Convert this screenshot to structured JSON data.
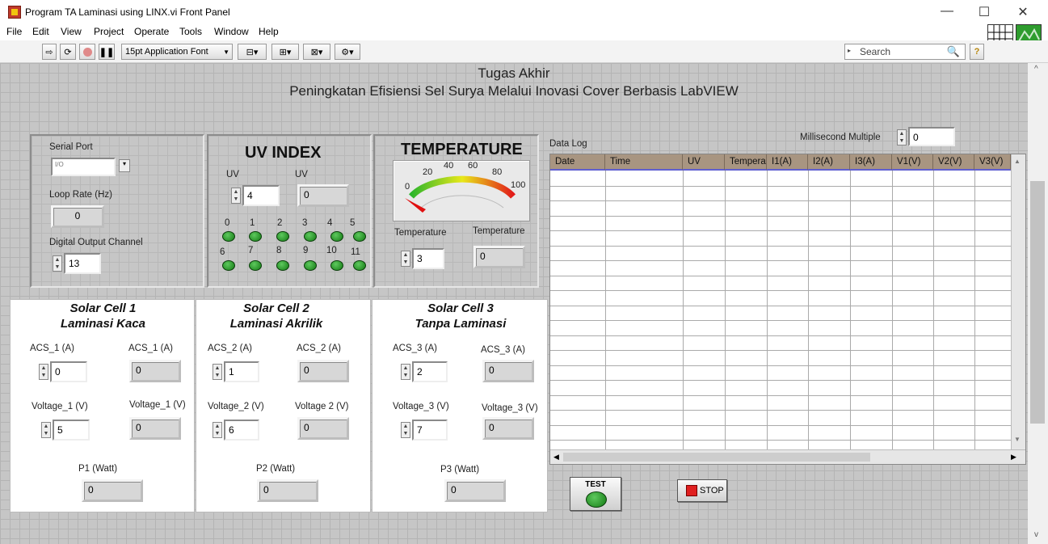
{
  "window": {
    "title": "Program TA Laminasi using LINX.vi Front Panel",
    "minimize": "—",
    "maximize": "☐",
    "close": "✕"
  },
  "menu": [
    "File",
    "Edit",
    "View",
    "Project",
    "Operate",
    "Tools",
    "Window",
    "Help"
  ],
  "toolbar": {
    "font": "15pt Application Font",
    "search_placeholder": "Search",
    "help": "?"
  },
  "header": {
    "line1": "Tugas Akhir",
    "line2": "Peningkatan Efisiensi Sel Surya Melalui Inovasi Cover Berbasis LabVIEW"
  },
  "config": {
    "serial_port_label": "Serial Port",
    "serial_port_value": "",
    "loop_rate_label": "Loop Rate (Hz)",
    "loop_rate_value": "0",
    "digital_output_label": "Digital Output Channel",
    "digital_output_value": "13"
  },
  "uv": {
    "title": "UV INDEX",
    "control_label": "UV",
    "control_value": "4",
    "indicator_label": "UV",
    "indicator_value": "0",
    "led_row1": [
      "0",
      "1",
      "2",
      "3",
      "4",
      "5"
    ],
    "led_row2": [
      "6",
      "7",
      "8",
      "9",
      "10",
      "11"
    ]
  },
  "temperature": {
    "title": "TEMPERATURE",
    "gauge_ticks": [
      "0",
      "20",
      "40",
      "60",
      "80",
      "100"
    ],
    "gauge_level": 0,
    "control_label": "Temperature",
    "control_value": "3",
    "indicator_label": "Temperature",
    "indicator_value": "0"
  },
  "datalog": {
    "label": "Data Log",
    "ms_label": "Millisecond Multiple",
    "ms_value": "0",
    "columns": [
      "Date",
      "Time",
      "UV",
      "Tempera",
      "I1(A)",
      "I2(A)",
      "I3(A)",
      "V1(V)",
      "V2(V)",
      "V3(V)"
    ]
  },
  "solar": [
    {
      "title1": "Solar Cell 1",
      "title2": "Laminasi Kaca",
      "acs_ctrl_label": "ACS_1 (A)",
      "acs_ctrl": "0",
      "acs_ind_label": "ACS_1 (A)",
      "acs_ind": "0",
      "v_ctrl_label": "Voltage_1 (V)",
      "v_ctrl": "5",
      "v_ind_label": "Voltage_1 (V)",
      "v_ind": "0",
      "p_label": "P1 (Watt)",
      "p": "0"
    },
    {
      "title1": "Solar Cell 2",
      "title2": "Laminasi Akrilik",
      "acs_ctrl_label": "ACS_2 (A)",
      "acs_ctrl": "1",
      "acs_ind_label": "ACS_2 (A)",
      "acs_ind": "0",
      "v_ctrl_label": "Voltage_2 (V)",
      "v_ctrl": "6",
      "v_ind_label": "Voltage 2 (V)",
      "v_ind": "0",
      "p_label": "P2 (Watt)",
      "p": "0"
    },
    {
      "title1": "Solar Cell 3",
      "title2": "Tanpa Laminasi",
      "acs_ctrl_label": "ACS_3 (A)",
      "acs_ctrl": "2",
      "acs_ind_label": "ACS_3 (A)",
      "acs_ind": "0",
      "v_ctrl_label": "Voltage_3 (V)",
      "v_ctrl": "7",
      "v_ind_label": "Voltage_3 (V)",
      "v_ind": "0",
      "p_label": "P3 (Watt)",
      "p": "0"
    }
  ],
  "buttons": {
    "test": "TEST",
    "stop": "STOP"
  },
  "colors": {
    "panel": "#c6c6c6",
    "table_header": "#a89581",
    "led_green": "#2aa02a",
    "stop_red": "#e02020"
  }
}
